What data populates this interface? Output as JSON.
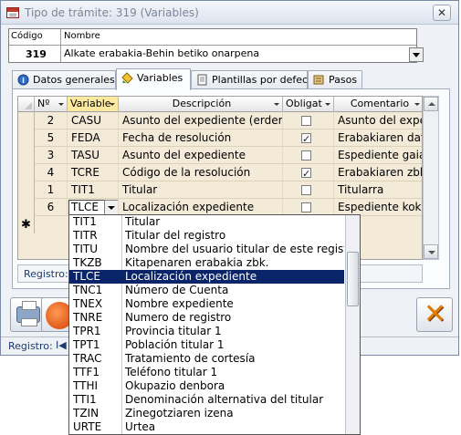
{
  "window": {
    "title": "Tipo de trámite: 319 (Variables)",
    "close_label": "✕"
  },
  "header": {
    "codigo_label": "Código",
    "nombre_label": "Nombre",
    "codigo_value": "319",
    "nombre_value": "Alkate erabakia-Behin betiko onarpena"
  },
  "tabs": [
    {
      "label": "Datos generales",
      "icon": "info-icon"
    },
    {
      "label": "Variables",
      "icon": "variables-icon"
    },
    {
      "label": "Plantillas por defecto",
      "icon": "document-icon"
    },
    {
      "label": "Pasos",
      "icon": "steps-icon"
    }
  ],
  "grid": {
    "columns": [
      "Nº",
      "Variable",
      "Descripción",
      "Obligat",
      "Comentario"
    ],
    "rows": [
      {
        "n": "2",
        "variable": "CASU",
        "descripcion": "Asunto del expediente (erderaz",
        "obligatorio": false,
        "comentario": "Asunto del expedi"
      },
      {
        "n": "5",
        "variable": "FEDA",
        "descripcion": "Fecha de resolución",
        "obligatorio": true,
        "comentario": "Erabakiaren data"
      },
      {
        "n": "3",
        "variable": "TASU",
        "descripcion": "Asunto del expediente",
        "obligatorio": false,
        "comentario": "Espediente gaia"
      },
      {
        "n": "4",
        "variable": "TCRE",
        "descripcion": "Código de la resolución",
        "obligatorio": true,
        "comentario": "Erabakiaren zbk."
      },
      {
        "n": "1",
        "variable": "TIT1",
        "descripcion": "Titular",
        "obligatorio": false,
        "comentario": "Titularra"
      },
      {
        "n": "6",
        "variable": "TLCE",
        "descripcion": "Localización expediente",
        "obligatorio": false,
        "comentario": "Espediente kokap"
      }
    ],
    "new_row_marker": "✱"
  },
  "inner_record_label": "Registro:",
  "status": {
    "record_label": "Registro:",
    "nav_first": "I◀"
  },
  "dropdown": {
    "items": [
      {
        "code": "TIT1",
        "desc": "Titular"
      },
      {
        "code": "TITR",
        "desc": "Titular del registro"
      },
      {
        "code": "TITU",
        "desc": "Nombre del usuario titular de este registro"
      },
      {
        "code": "TKZB",
        "desc": "Kitapenaren erabakia zbk."
      },
      {
        "code": "TLCE",
        "desc": "Localización expediente",
        "selected": true
      },
      {
        "code": "TNC1",
        "desc": "Número de Cuenta"
      },
      {
        "code": "TNEX",
        "desc": "Nombre expediente"
      },
      {
        "code": "TNRE",
        "desc": "Numero de registro"
      },
      {
        "code": "TPR1",
        "desc": "Provincia titular 1"
      },
      {
        "code": "TPT1",
        "desc": "Población titular 1"
      },
      {
        "code": "TRAC",
        "desc": "Tratamiento de cortesía"
      },
      {
        "code": "TTF1",
        "desc": "Teléfono titular 1"
      },
      {
        "code": "TTHI",
        "desc": "Okupazio denbora"
      },
      {
        "code": "TTI1",
        "desc": "Denominación alternativa del titular"
      },
      {
        "code": "TZIN",
        "desc": "Zinegotziaren izena"
      },
      {
        "code": "URTE",
        "desc": "Urtea"
      }
    ]
  },
  "colors": {
    "grid_bg": "#f3ead8",
    "selection": "#0a246a",
    "active_header": "#fde9a0"
  }
}
